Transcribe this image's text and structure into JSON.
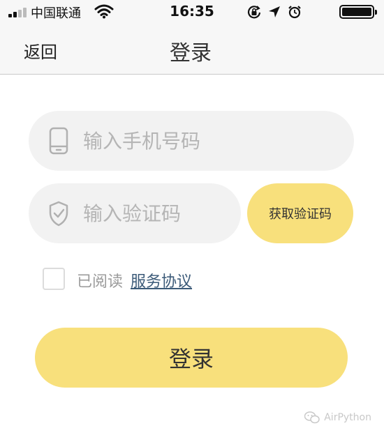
{
  "status_bar": {
    "carrier": "中国联通",
    "time": "16:35",
    "icons": [
      "signal-icon",
      "wifi-icon",
      "rotation-lock-icon",
      "location-arrow-icon",
      "alarm-icon",
      "battery-icon"
    ]
  },
  "nav": {
    "back_label": "返回",
    "title": "登录"
  },
  "form": {
    "phone": {
      "value": "",
      "placeholder": "输入手机号码",
      "icon": "phone-icon"
    },
    "code": {
      "value": "",
      "placeholder": "输入验证码",
      "icon": "shield-check-icon"
    },
    "get_code_label": "获取验证码"
  },
  "agreement": {
    "checked": false,
    "prefix": "已阅读",
    "link": "服务协议"
  },
  "login_label": "登录",
  "watermark": "AirPython",
  "colors": {
    "accent": "#f8e07c",
    "input_bg": "#f2f2f2",
    "link": "#3b5a78",
    "bar_bg": "#f7f7f7"
  }
}
